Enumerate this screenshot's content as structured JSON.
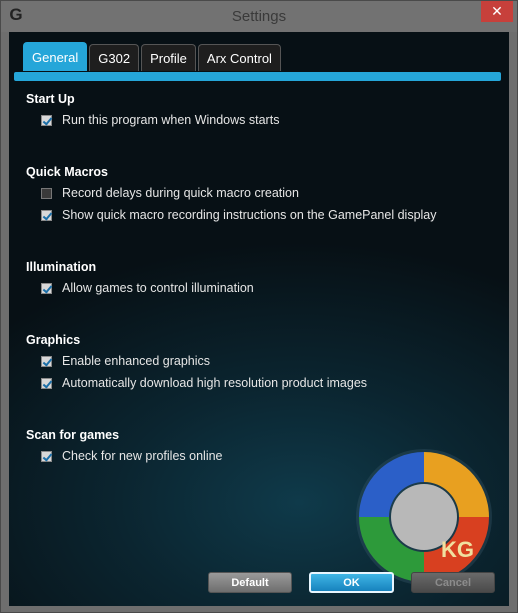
{
  "window": {
    "title": "Settings",
    "close_glyph": "✕",
    "app_icon": "logitech-g-icon"
  },
  "tabs": [
    {
      "label": "General",
      "active": true
    },
    {
      "label": "G302",
      "active": false
    },
    {
      "label": "Profile",
      "active": false
    },
    {
      "label": "Arx Control",
      "active": false
    }
  ],
  "sections": [
    {
      "title": "Start Up",
      "options": [
        {
          "label": "Run this program when Windows starts",
          "checked": true
        }
      ]
    },
    {
      "title": "Quick Macros",
      "options": [
        {
          "label": "Record delays during quick macro creation",
          "checked": false
        },
        {
          "label": "Show quick macro recording instructions on the GamePanel display",
          "checked": true
        }
      ]
    },
    {
      "title": "Illumination",
      "options": [
        {
          "label": "Allow games to control illumination",
          "checked": true
        }
      ]
    },
    {
      "title": "Graphics",
      "options": [
        {
          "label": "Enable enhanced graphics",
          "checked": true
        },
        {
          "label": "Automatically download high resolution product images",
          "checked": true
        }
      ]
    },
    {
      "title": "Scan for games",
      "options": [
        {
          "label": "Check for new profiles online",
          "checked": true
        }
      ]
    }
  ],
  "buttons": {
    "default_label": "Default",
    "ok_label": "OK",
    "cancel_label": "Cancel"
  },
  "watermark": {
    "text": "KG"
  },
  "colors": {
    "accent": "#25a6d9",
    "close": "#c7403b"
  }
}
